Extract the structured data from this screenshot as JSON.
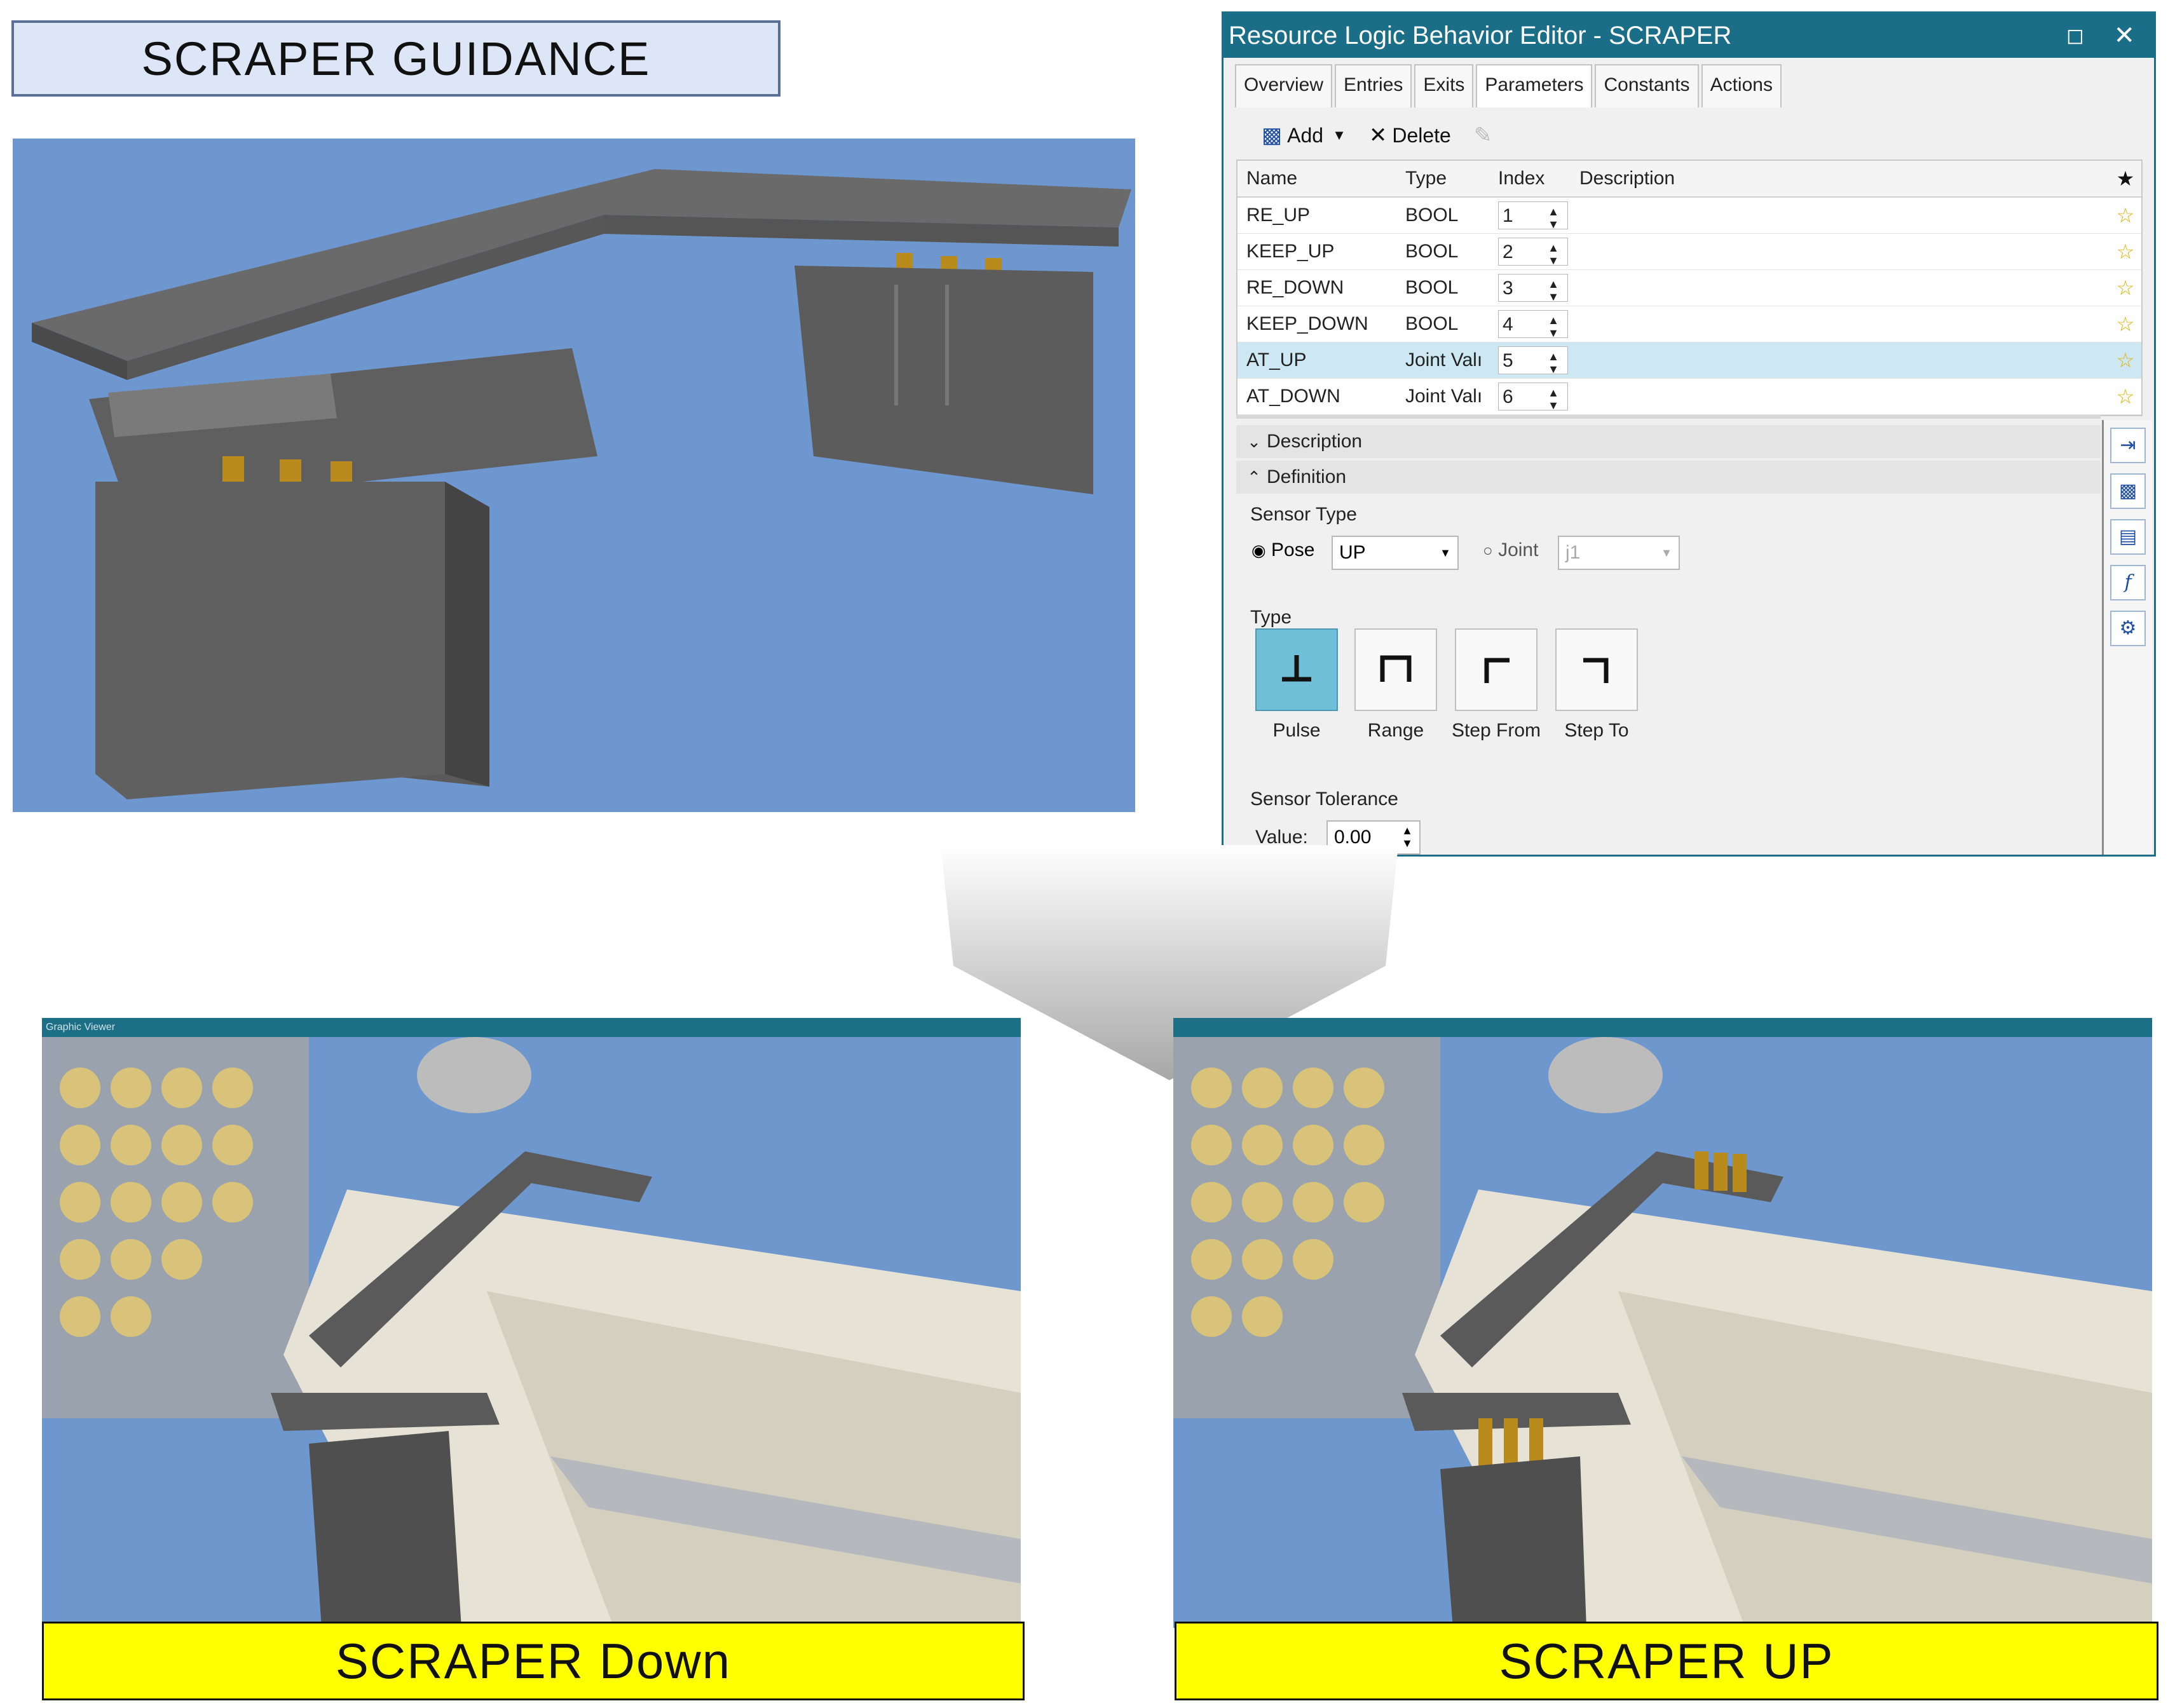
{
  "header": {
    "title": "SCRAPER GUIDANCE"
  },
  "editor": {
    "title": "Resource Logic Behavior Editor - SCRAPER",
    "maximize_icon": "maximize-icon",
    "close_icon": "close-icon",
    "tabs": [
      "Overview",
      "Entries",
      "Exits",
      "Parameters",
      "Constants",
      "Actions"
    ],
    "active_tab": "Parameters",
    "toolbar": {
      "add_label": "Add",
      "delete_label": "Delete"
    },
    "columns": [
      "Name",
      "Type",
      "Index",
      "Description"
    ],
    "rows": [
      {
        "name": "RE_UP",
        "type": "BOOL",
        "index": "1",
        "description": ""
      },
      {
        "name": "KEEP_UP",
        "type": "BOOL",
        "index": "2",
        "description": ""
      },
      {
        "name": "RE_DOWN",
        "type": "BOOL",
        "index": "3",
        "description": ""
      },
      {
        "name": "KEEP_DOWN",
        "type": "BOOL",
        "index": "4",
        "description": ""
      },
      {
        "name": "AT_UP",
        "type": "Joint Valı",
        "index": "5",
        "description": ""
      },
      {
        "name": "AT_DOWN",
        "type": "Joint Valı",
        "index": "6",
        "description": ""
      }
    ],
    "selected_row": "AT_UP",
    "sections": {
      "description": "Description",
      "definition": "Definition"
    },
    "sensor_type": {
      "label": "Sensor Type",
      "pose_label": "Pose",
      "pose_value": "UP",
      "joint_label": "Joint",
      "joint_value": "j1",
      "selected": "Pose"
    },
    "type": {
      "label": "Type",
      "options": [
        "Pulse",
        "Range",
        "Step From",
        "Step To"
      ],
      "selected": "Pulse"
    },
    "sensor_tolerance": {
      "label": "Sensor Tolerance",
      "value_label": "Value:",
      "value": "0.00"
    },
    "colors": {
      "titlebar": "#1a6e88",
      "selected_row": "#cde8f3",
      "selected_type": "#6fbfd6",
      "star": "#e0b100"
    }
  },
  "viewports": {
    "left_bar": "Graphic Viewer",
    "right_bar": ""
  },
  "captions": {
    "left": "SCRAPER Down",
    "right": "SCRAPER UP"
  },
  "colors": {
    "scene_background": "#6f97cf",
    "caption_background": "#ffff00",
    "title_background": "#dde6f6"
  }
}
